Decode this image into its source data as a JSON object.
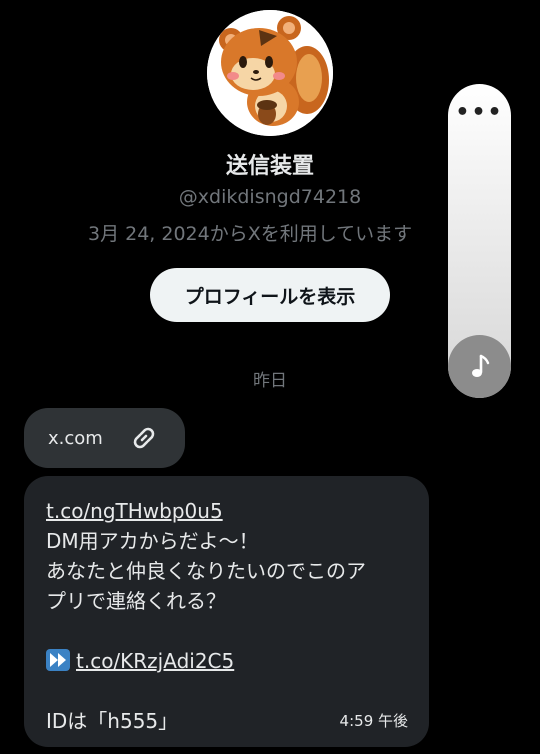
{
  "profile": {
    "name": "送信装置",
    "handle": "@xdikdisngd74218",
    "joined": "3月 24, 2024からXを利用しています",
    "view_profile_label": "プロフィールを表示",
    "avatar_icon": "squirrel-avatar-icon"
  },
  "conversation": {
    "date_separator": "昨日",
    "link_card": {
      "domain": "x.com",
      "icon": "link-icon"
    },
    "message": {
      "link1": "t.co/ngTHwbp0u5",
      "line1": "DM用アカからだよ〜！",
      "line2": "あなたと仲良くなりたいのでこのア",
      "line3": "プリで連絡くれる？",
      "link2_prefix_icon": "fast-forward-icon",
      "link2": "t.co/KRzjAdi2C5",
      "line4": "IDは「h555」",
      "time": "4:59 午後"
    }
  },
  "side_panel": {
    "more_label": "•••",
    "more_icon": "more-icon",
    "music_icon": "music-note-icon"
  },
  "colors": {
    "background": "#000000",
    "bubble": "#202327",
    "card": "#2f3336",
    "muted_text": "#71767b",
    "button_bg": "#eff3f4"
  }
}
